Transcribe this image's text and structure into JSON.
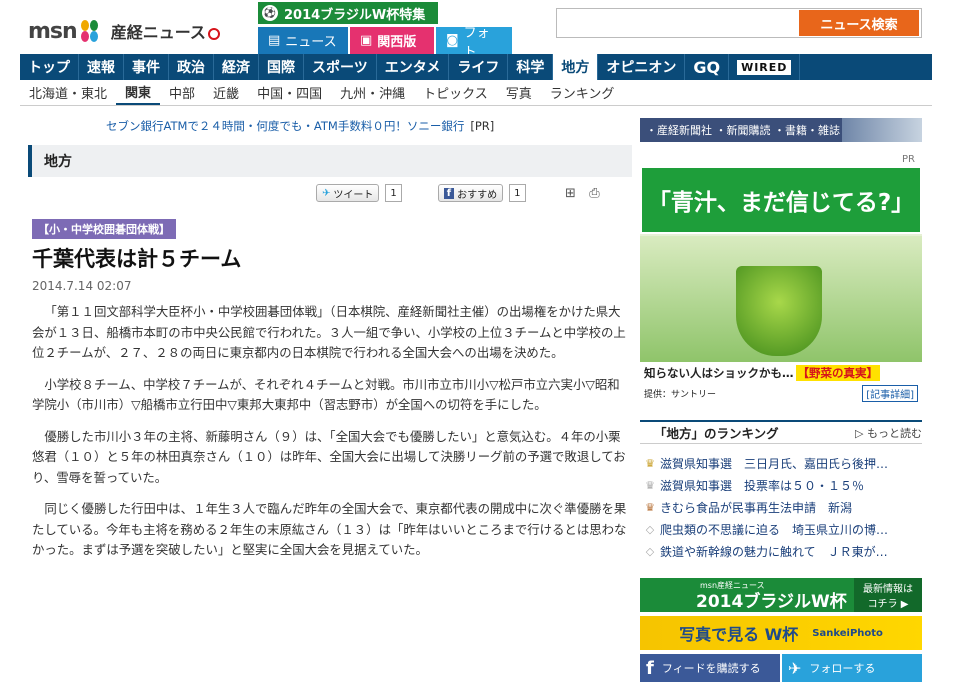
{
  "header": {
    "msn_logo": "msn",
    "sankei_logo": "産経ニュース",
    "wcup_tab": "2014ブラジルW杯特集",
    "subtabs": {
      "news": "ニュース",
      "kansai": "関西版",
      "photo": "フォト"
    },
    "search": {
      "placeholder": "",
      "button": "ニュース検索"
    }
  },
  "mainnav": [
    {
      "label": "トップ"
    },
    {
      "label": "速報"
    },
    {
      "label": "事件"
    },
    {
      "label": "政治"
    },
    {
      "label": "経済"
    },
    {
      "label": "国際"
    },
    {
      "label": "スポーツ"
    },
    {
      "label": "エンタメ"
    },
    {
      "label": "ライフ"
    },
    {
      "label": "科学"
    },
    {
      "label": "地方"
    },
    {
      "label": "オピニオン"
    },
    {
      "label": "GQ"
    },
    {
      "label": "WIRED"
    }
  ],
  "mainnav_active": "地方",
  "subnav": [
    {
      "label": "北海道・東北"
    },
    {
      "label": "関東"
    },
    {
      "label": "中部"
    },
    {
      "label": "近畿"
    },
    {
      "label": "中国・四国"
    },
    {
      "label": "九州・沖縄"
    },
    {
      "label": "トピックス"
    },
    {
      "label": "写真"
    },
    {
      "label": "ランキング"
    }
  ],
  "subnav_active": "関東",
  "pr_line": {
    "text": "セブン銀行ATMで２４時間・何度でも・ATM手数料０円！ソニー銀行",
    "tag": "[PR]"
  },
  "section_title": "地方",
  "share": {
    "tweet": "ツイート",
    "tweet_count": "1",
    "like": "おすすめ",
    "like_count": "1"
  },
  "article": {
    "badge": "【小・中学校囲碁団体戦】",
    "title": "千葉代表は計５チーム",
    "date": "2014.7.14 02:07",
    "paragraphs": [
      "「第１１回文部科学大臣杯小・中学校囲碁団体戦」（日本棋院、産経新聞社主催）の出場権をかけた県大会が１３日、船橋市本町の市中央公民館で行われた。３人一組で争い、小学校の上位３チームと中学校の上位２チームが、２７、２８の両日に東京都内の日本棋院で行われる全国大会への出場を決めた。",
      "小学校８チーム、中学校７チームが、それぞれ４チームと対戦。市川市立市川小▽松戸市立六実小▽昭和学院小（市川市）▽船橋市立行田中▽東邦大東邦中（習志野市）が全国への切符を手にした。",
      "優勝した市川小３年の主将、新藤明さん（９）は、「全国大会でも優勝したい」と意気込む。４年の小栗悠君（１０）と５年の林田真奈さん（１０）は昨年、全国大会に出場して決勝リーグ前の予選で敗退しており、雪辱を誓っていた。",
      "同じく優勝した行田中は、１年生３人で臨んだ昨年の全国大会で、東京都代表の開成中に次ぐ準優勝を果たしている。今年も主将を務める２年生の末原紘さん（１３）は「昨年はいいところまで行けるとは思わなかった。まずは予選を突破したい」と堅実に全国大会を見据えていた。"
    ]
  },
  "sidebar": {
    "banner": "・産経新聞社 ・新聞購読 ・書籍・雑誌",
    "pr_label": "PR",
    "ad": {
      "headline": "「青汁、まだ信じてる?」",
      "caption": "知らない人はショックかも…",
      "caption_highlight": "【野菜の真実】",
      "sponsor": "提供：サントリー",
      "detail": "[記事詳細]"
    },
    "ranking": {
      "title": "「地方」のランキング",
      "more": "▷ もっと読む",
      "items": [
        {
          "label": "滋賀県知事選　三日月氏、嘉田氏ら後押…"
        },
        {
          "label": "滋賀県知事選　投票率は５０・１５％"
        },
        {
          "label": "きむら食品が民事再生法申請　新潟"
        },
        {
          "label": "爬虫類の不思議に迫る　埼玉県立川の博…"
        },
        {
          "label": "鉄道や新幹線の魅力に触れて　ＪＲ東が…"
        }
      ]
    },
    "wc_banner": {
      "brand": "msn産経ニュース",
      "label": "2014ブラジルW杯",
      "side_top": "最新情報は",
      "side_bottom": "コチラ ▶"
    },
    "photo_banner": {
      "label": "写真で見る W杯",
      "brand": "SankeiPhoto"
    },
    "follow": {
      "facebook": "フィードを購読する",
      "twitter": "フォローする"
    }
  }
}
